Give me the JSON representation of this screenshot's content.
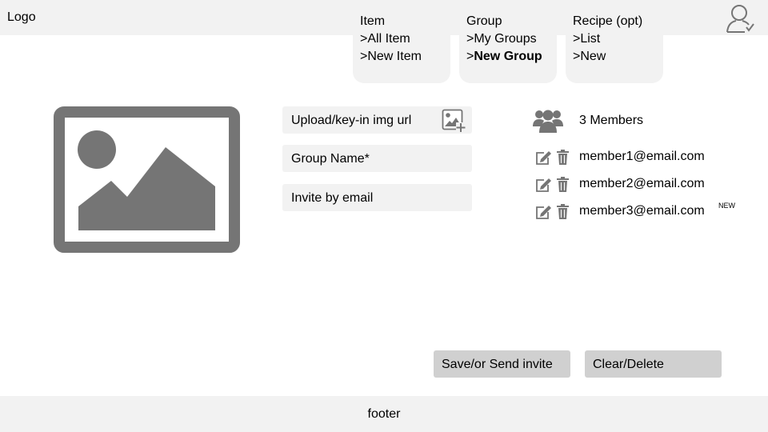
{
  "header": {
    "logo": "Logo",
    "user_icon": "user-account-icon"
  },
  "nav": {
    "item": {
      "title": "Item",
      "links": [
        ">All Item",
        ">New Item"
      ]
    },
    "group": {
      "title": "Group",
      "links": [
        ">My Groups"
      ],
      "active_prefix": ">",
      "active_label": "New Group"
    },
    "recipe": {
      "title": "Recipe (opt)",
      "links": [
        ">List",
        ">New"
      ]
    }
  },
  "form": {
    "upload": "Upload/key-in img url",
    "group_name": "Group Name*",
    "invite": "Invite by email"
  },
  "members": {
    "count_label": "3 Members",
    "items": [
      {
        "email": "member1@email.com",
        "badge": ""
      },
      {
        "email": "member2@email.com",
        "badge": ""
      },
      {
        "email": "member3@email.com",
        "badge": "NEW"
      }
    ]
  },
  "actions": {
    "save": "Save/or Send invite",
    "clear": "Clear/Delete"
  },
  "footer": {
    "text": "footer"
  },
  "colors": {
    "bar": "#f2f2f2",
    "button": "#d0d0d0",
    "icon": "#757575"
  }
}
